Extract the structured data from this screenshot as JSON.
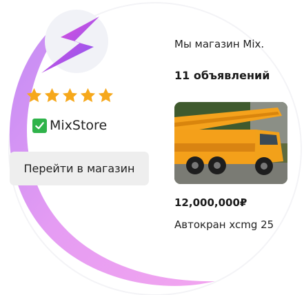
{
  "store": {
    "logo_icon": "lightning-bolt-icon",
    "rating_stars": 5,
    "verified_icon": "green-check-icon",
    "name": "MixStore",
    "go_to_store_label": "Перейти в магазин"
  },
  "profile": {
    "about_text": "Мы магазин Mix.",
    "ads_count_text": "11 объявлений"
  },
  "ads": [
    {
      "image_icon": "truck-crane-photo",
      "price": "12,000,000₽",
      "title": "Автокран xcmg 25"
    }
  ],
  "colors": {
    "accent_pink": "#e79af4",
    "accent_purple": "#8a5cf5",
    "accent_magenta": "#f04ad6",
    "star_gold": "#f6a81b",
    "check_green": "#2fb34a",
    "button_bg": "#eeeeee"
  }
}
